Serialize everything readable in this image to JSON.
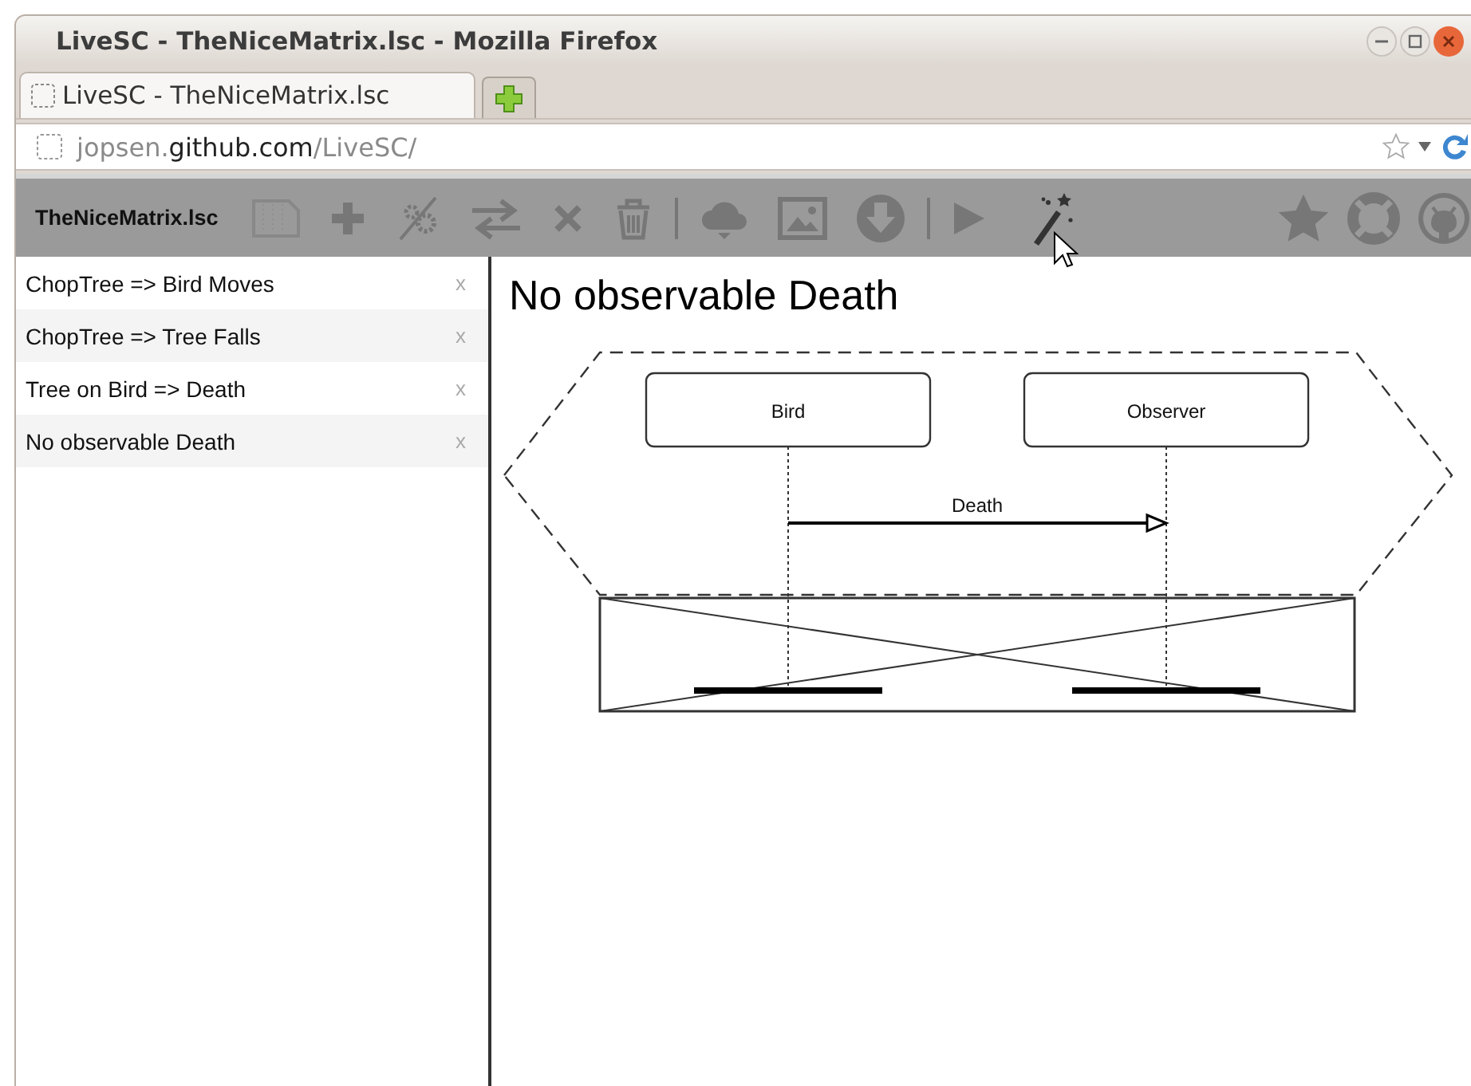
{
  "window": {
    "title": "LiveSC - TheNiceMatrix.lsc - Mozilla Firefox"
  },
  "tabs": [
    {
      "label": "LiveSC - TheNiceMatrix.lsc",
      "selected": true
    }
  ],
  "address_bar": {
    "url_parts": [
      {
        "text": "jopsen.",
        "kind": "dim"
      },
      {
        "text": "github.com",
        "kind": "host"
      },
      {
        "text": "/LiveSC/",
        "kind": "dim"
      }
    ]
  },
  "toolbar": {
    "file_name": "TheNiceMatrix.lsc"
  },
  "sidebar": {
    "items": [
      {
        "label": "ChopTree => Bird Moves",
        "close": "x"
      },
      {
        "label": "ChopTree => Tree Falls",
        "close": "x"
      },
      {
        "label": "Tree on Bird => Death",
        "close": "x"
      },
      {
        "label": "No observable Death",
        "close": "x"
      }
    ]
  },
  "chart": {
    "title": "No observable Death",
    "instances": [
      "Bird",
      "Observer"
    ],
    "message": {
      "label": "Death"
    }
  }
}
